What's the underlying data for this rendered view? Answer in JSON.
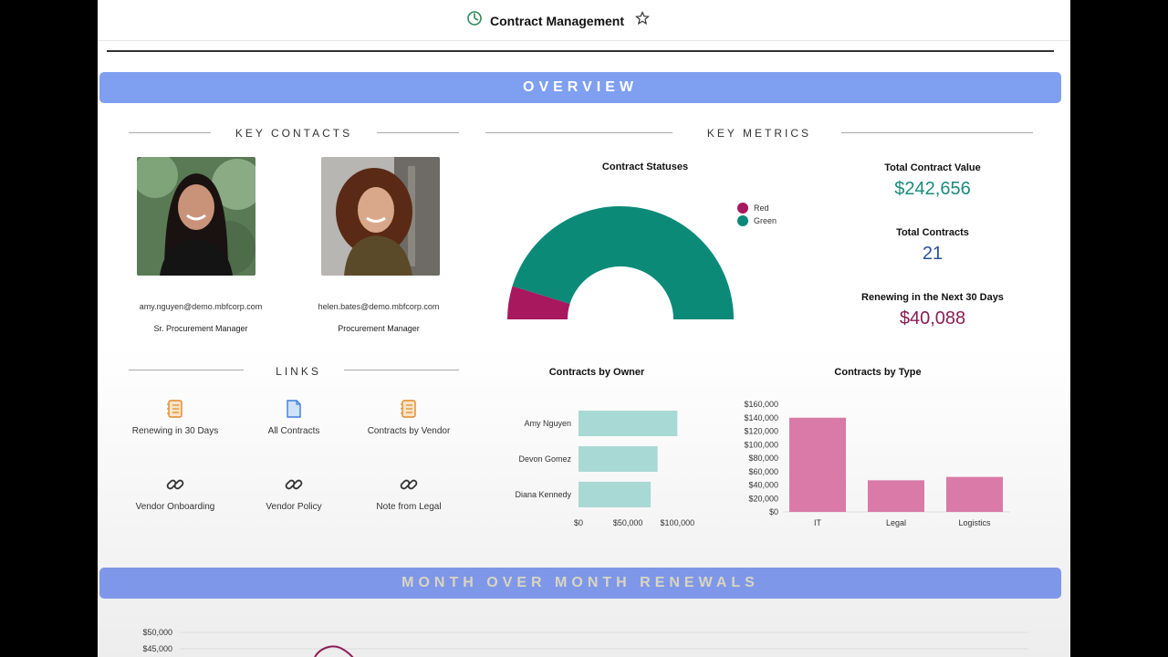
{
  "header": {
    "title": "Contract Management"
  },
  "overview_banner": "OVERVIEW",
  "key_contacts": {
    "heading": "KEY CONTACTS",
    "contacts": [
      {
        "email": "amy.nguyen@demo.mbfcorp.com",
        "role": "Sr. Procurement Manager"
      },
      {
        "email": "helen.bates@demo.mbfcorp.com",
        "role": "Procurement Manager"
      }
    ]
  },
  "links": {
    "heading": "LINKS",
    "items": [
      {
        "label": "Renewing in 30 Days",
        "icon": "notebook-icon"
      },
      {
        "label": "All Contracts",
        "icon": "document-icon"
      },
      {
        "label": "Contracts by Vendor",
        "icon": "notebook-icon"
      },
      {
        "label": "Vendor Onboarding",
        "icon": "link-icon"
      },
      {
        "label": "Vendor Policy",
        "icon": "link-icon"
      },
      {
        "label": "Note from Legal",
        "icon": "link-icon"
      }
    ]
  },
  "key_metrics": {
    "heading": "KEY METRICS",
    "total_value_label": "Total Contract Value",
    "total_value": "$242,656",
    "total_contracts_label": "Total Contracts",
    "total_contracts": "21",
    "renewing_label": "Renewing in the Next 30 Days",
    "renewing_value": "$40,088"
  },
  "colors": {
    "accent_banner": "#7f9ff0",
    "red_status": "#a7185f",
    "green_status": "#0b8a78",
    "value_green": "#1a8a7a",
    "value_blue": "#2a4f9a",
    "value_maroon": "#8a1d55",
    "owner_bar": "#a9d9d4",
    "type_bar": "#d97aa8"
  },
  "mom_banner": "MONTH OVER MONTH RENEWALS",
  "chart_data": [
    {
      "type": "pie",
      "variant": "half-donut",
      "title": "Contract Statuses",
      "labels": [
        "Red",
        "Green"
      ],
      "values": [
        2,
        19
      ],
      "legend": "top-right"
    },
    {
      "type": "bar",
      "orientation": "horizontal",
      "title": "Contracts by Owner",
      "categories": [
        "Amy Nguyen",
        "Devon Gomez",
        "Diana Kennedy"
      ],
      "values": [
        100000,
        80000,
        73000
      ],
      "xticks": [
        "$0",
        "$50,000",
        "$100,000"
      ],
      "xlim": [
        0,
        120000
      ]
    },
    {
      "type": "bar",
      "title": "Contracts by Type",
      "categories": [
        "IT",
        "Legal",
        "Logistics"
      ],
      "values": [
        140000,
        47000,
        52000
      ],
      "yticks": [
        "$0",
        "$20,000",
        "$40,000",
        "$60,000",
        "$80,000",
        "$100,000",
        "$120,000",
        "$140,000",
        "$160,000"
      ],
      "ylim": [
        0,
        160000
      ]
    },
    {
      "type": "line",
      "title": "",
      "yticks": [
        "$50,000",
        "$45,000"
      ],
      "partial": true
    }
  ]
}
